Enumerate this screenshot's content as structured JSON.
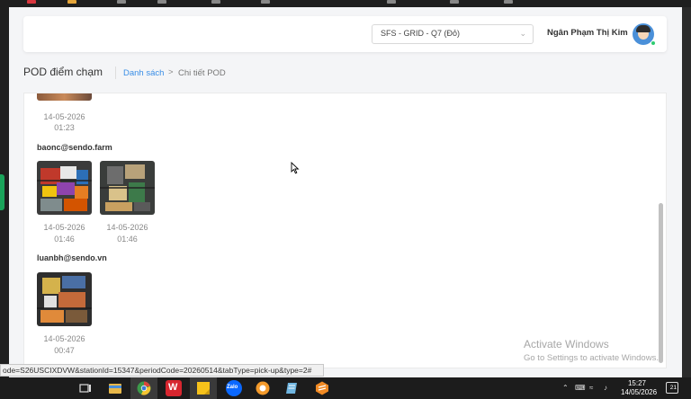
{
  "app_header": {
    "station_select": {
      "value": "SFS - GRID - Q7 (Đỏ)"
    },
    "user_name": "Ngân Phạm Thị Kim"
  },
  "page": {
    "title": "POD điểm chạm",
    "breadcrumb": {
      "link": "Danh sách",
      "separator": ">",
      "current": "Chi tiết POD"
    }
  },
  "pod": {
    "first_partial": {
      "date": "14-05-2026",
      "time": "01:23"
    },
    "groups": [
      {
        "uploader": "baonc@sendo.farm",
        "photos": [
          {
            "date": "14-05-2026",
            "time": "01:46"
          },
          {
            "date": "14-05-2026",
            "time": "01:46"
          }
        ]
      },
      {
        "uploader": "luanbh@sendo.vn",
        "photos": [
          {
            "date": "14-05-2026",
            "time": "00:47"
          }
        ]
      }
    ]
  },
  "windows": {
    "activate_title": "Activate Windows",
    "activate_subtitle": "Go to Settings to activate Windows."
  },
  "status_bar": {
    "url": "ode=S26USCIXDVW&stationId=15347&periodCode=20260514&tabType=pick-up&type=2#"
  },
  "taskbar": {
    "icons": [
      "task-view-icon",
      "file-explorer-icon",
      "chrome-icon",
      "wps-office-icon",
      "sticky-notes-icon",
      "zalo-icon",
      "app-circle-icon",
      "notepad-icon",
      "sublime-text-icon"
    ],
    "zalo_label": "Zalo",
    "wps_label": "W",
    "clock_time": "15:27",
    "clock_date": "14/05/2026",
    "notification_count": "21"
  }
}
